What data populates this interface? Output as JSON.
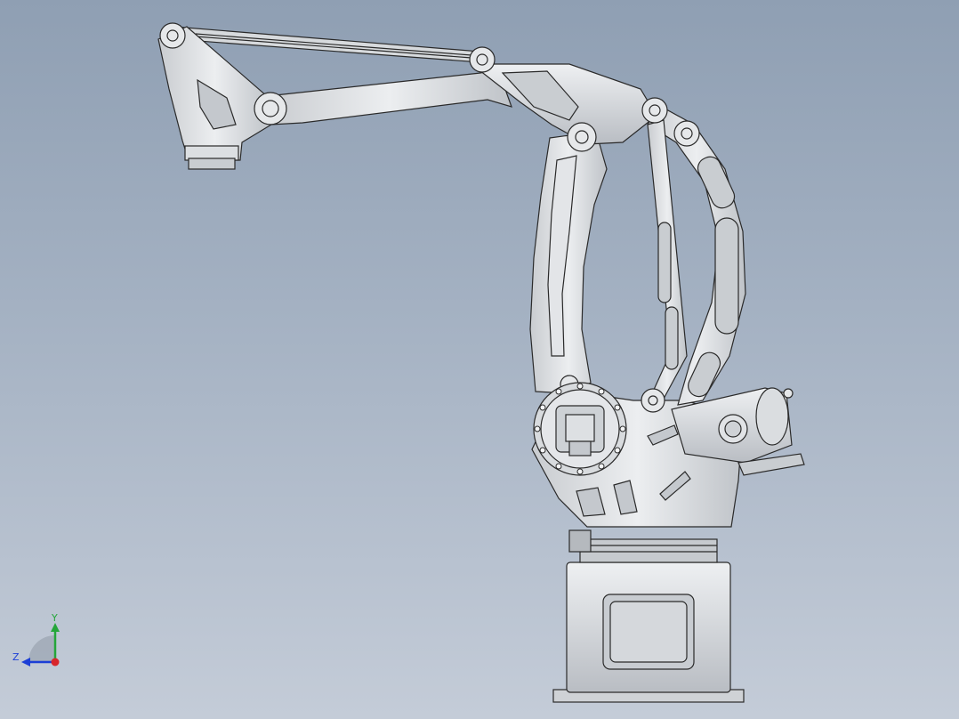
{
  "viewport": {
    "background_top": "#8f9fb3",
    "background_bottom": "#c4ccd8",
    "part_fill": "#d9dcdf",
    "part_stroke": "#2a2a2a"
  },
  "triad": {
    "x_color": "#d8252b",
    "y_color": "#25a63a",
    "z_color": "#1c3fd6",
    "y_label": "Y",
    "z_label": "Z"
  }
}
